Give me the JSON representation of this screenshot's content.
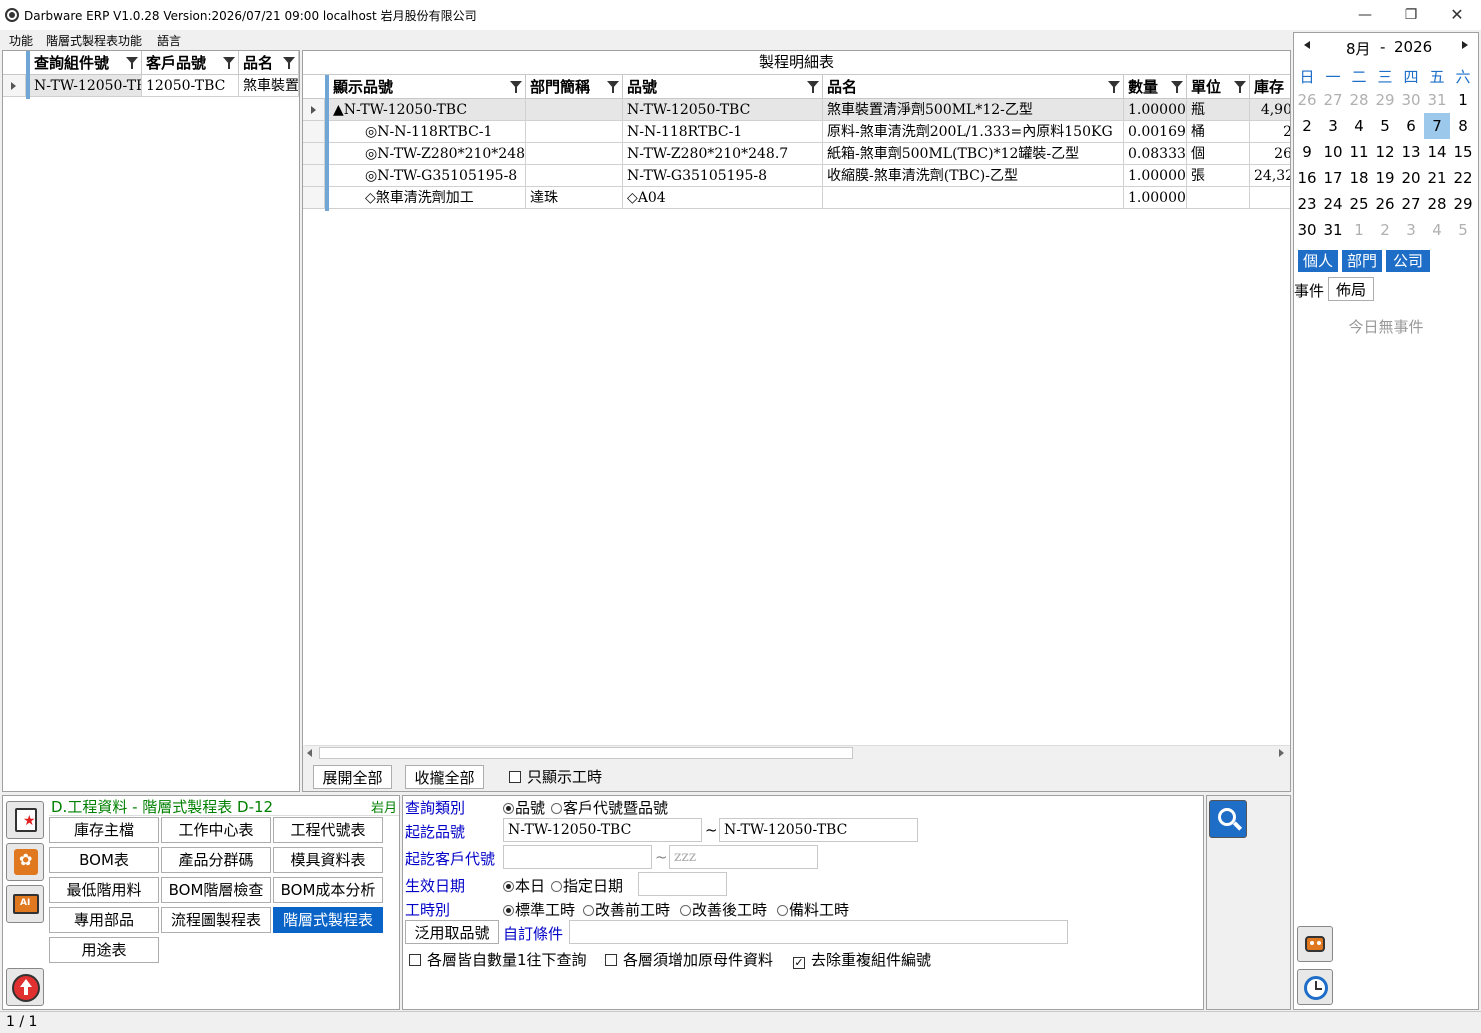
{
  "window": {
    "title": "Darbware ERP V1.0.28 Version:2026/07/21 09:00   localhost 岩月股份有限公司",
    "minimize_icon": "minimize-icon",
    "restore_icon": "restore-icon",
    "close_icon": "close-icon"
  },
  "menu": {
    "items": [
      "功能",
      "階層式製程表功能",
      "語言"
    ]
  },
  "left_grid": {
    "columns": [
      "查詢組件號",
      "客戶品號",
      "品名"
    ],
    "rows": [
      [
        "N-TW-12050-TB",
        "12050-TBC",
        "煞車裝置"
      ]
    ]
  },
  "detail": {
    "title": "製程明細表",
    "columns": [
      "顯示品號",
      "部門簡稱",
      "品號",
      "品名",
      "數量",
      "單位",
      "庫存"
    ],
    "rows": [
      [
        "▲N-TW-12050-TBC",
        "",
        "N-TW-12050-TBC",
        "煞車裝置清淨劑500ML*12-乙型",
        "1.00000",
        "瓶",
        "4,90"
      ],
      [
        "◎N-N-118RTBC-1",
        "",
        "N-N-118RTBC-1",
        "原料-煞車清洗劑200L/1.333=內原料150KG",
        "0.00169",
        "桶",
        "2"
      ],
      [
        "◎N-TW-Z280*210*248.",
        "",
        "N-TW-Z280*210*248.7",
        "紙箱-煞車劑500ML(TBC)*12罐裝-乙型",
        "0.08333",
        "個",
        "26"
      ],
      [
        "◎N-TW-G35105195-8",
        "",
        "N-TW-G35105195-8",
        "收縮膜-煞車清洗劑(TBC)-乙型",
        "1.00000",
        "張",
        "24,32"
      ],
      [
        "◇煞車清洗劑加工",
        "達珠",
        "◇A04",
        "",
        "1.00000",
        "",
        ""
      ]
    ],
    "expand_all": "展開全部",
    "collapse_all": "收攏全部",
    "only_hours_label": "只顯示工時"
  },
  "module": {
    "title": "D.工程資料 - 階層式製程表  D-12",
    "tag": "岩月",
    "nav": [
      "庫存主檔",
      "工作中心表",
      "工程代號表",
      "BOM表",
      "產品分群碼",
      "模具資料表",
      "最低階用料",
      "BOM階層檢查",
      "BOM成本分析",
      "專用部品",
      "流程圖製程表",
      "階層式製程表",
      "用途表"
    ]
  },
  "query": {
    "type_label": "查詢類別",
    "type_opt1": "品號",
    "type_opt2": "客戶代號暨品號",
    "start_item_label": "起訖品號",
    "start_item_from": "N-TW-12050-TBC",
    "start_item_to": "N-TW-12050-TBC",
    "cust_label": "起訖客戶代號",
    "cust_from": "",
    "cust_to_placeholder": "zzz",
    "effdate_label": "生效日期",
    "effdate_opt1": "本日",
    "effdate_opt2": "指定日期",
    "hours_label": "工時別",
    "hours_opt1": "標準工時",
    "hours_opt2": "改善前工時",
    "hours_opt3": "改善後工時",
    "hours_opt4": "備料工時",
    "generic_btn": "泛用取品號",
    "custom_label": "自訂條件",
    "chk1": "各層皆自數量1往下查詢",
    "chk2": "各層須增加原母件資料",
    "chk3": "去除重複組件編號",
    "chk3_mark": "✓"
  },
  "calendar": {
    "month": "8月",
    "sep": "-",
    "year": "2026",
    "weekdays": [
      "日",
      "一",
      "二",
      "三",
      "四",
      "五",
      "六"
    ],
    "weeks": [
      [
        "26",
        "27",
        "28",
        "29",
        "30",
        "31",
        "1"
      ],
      [
        "2",
        "3",
        "4",
        "5",
        "6",
        "7",
        "8"
      ],
      [
        "9",
        "10",
        "11",
        "12",
        "13",
        "14",
        "15"
      ],
      [
        "16",
        "17",
        "18",
        "19",
        "20",
        "21",
        "22"
      ],
      [
        "23",
        "24",
        "25",
        "26",
        "27",
        "28",
        "29"
      ],
      [
        "30",
        "31",
        "1",
        "2",
        "3",
        "4",
        "5"
      ]
    ],
    "tabs": [
      "個人",
      "部門",
      "公司"
    ],
    "event_label": "事件",
    "layout_btn": "佈局",
    "no_events": "今日無事件"
  },
  "status": {
    "page": "1 / 1"
  },
  "colors": {
    "accent": "#1e6ec8",
    "active_nav": "#0a64c8",
    "module_title": "#008000",
    "query_label": "#0000c8"
  }
}
